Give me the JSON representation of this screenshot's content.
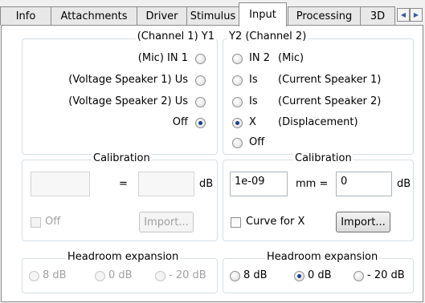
{
  "tabs": [
    {
      "label": "Info"
    },
    {
      "label": "Attachments"
    },
    {
      "label": "Driver"
    },
    {
      "label": "Stimulus"
    },
    {
      "label": "Input"
    },
    {
      "label": "Processing"
    },
    {
      "label": "3D"
    }
  ],
  "active_tab": "Input",
  "scroll_icons": {
    "left": "arrow-left-icon",
    "right": "arrow-right-icon"
  },
  "channel1": {
    "title": "(Channel 1)  Y1",
    "options": [
      {
        "label": "(Mic)  IN 1",
        "selected": false
      },
      {
        "label": "(Voltage Speaker 1)   Us",
        "selected": false
      },
      {
        "label": "(Voltage Speaker 2)   Us",
        "selected": false
      },
      {
        "label": "Off",
        "selected": true
      }
    ],
    "calibration": {
      "title": "Calibration",
      "equals": "=",
      "value_left": "",
      "value_right": "",
      "unit": "dB",
      "off_label": "Off",
      "off_checked": false,
      "import_label": "Import...",
      "enabled": false
    },
    "headroom": {
      "title": "Headroom expansion",
      "options": [
        {
          "label": "8 dB",
          "selected": false
        },
        {
          "label": "0 dB",
          "selected": false
        },
        {
          "label": "- 20 dB",
          "selected": false
        }
      ],
      "enabled": false
    }
  },
  "channel2": {
    "title": "Y2  (Channel 2)",
    "options": [
      {
        "label": "IN 2",
        "desc": "(Mic)",
        "selected": false
      },
      {
        "label": "Is",
        "desc": "(Current Speaker 1)",
        "selected": false
      },
      {
        "label": "Is",
        "desc": "(Current Speaker 2)",
        "selected": false
      },
      {
        "label": "X",
        "desc": "(Displacement)",
        "selected": true
      },
      {
        "label": "Off",
        "desc": "",
        "selected": false
      }
    ],
    "calibration": {
      "title": "Calibration",
      "value_left": "1e-09",
      "mid_label": "mm  =",
      "value_right": "0",
      "unit": "dB",
      "curve_label": "Curve for X",
      "curve_checked": false,
      "import_label": "Import..."
    },
    "headroom": {
      "title": "Headroom expansion",
      "options": [
        {
          "label": "8 dB",
          "selected": false
        },
        {
          "label": "0 dB",
          "selected": true
        },
        {
          "label": "- 20 dB",
          "selected": false
        }
      ]
    }
  }
}
